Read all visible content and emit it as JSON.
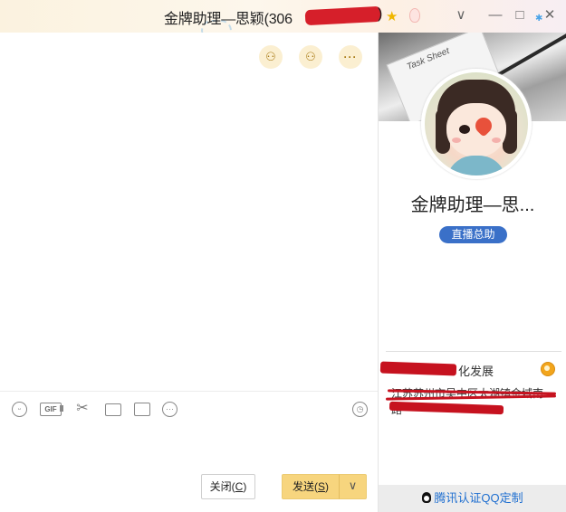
{
  "window": {
    "title": "金牌助理—思颖(306",
    "title_suffix": ")",
    "controls": {
      "dropdown": "∨",
      "minimize": "—",
      "maximize": "□",
      "close": "✕"
    }
  },
  "chat": {
    "toolbar_icons": [
      "smile-icon",
      "gif-icon",
      "scissors-icon",
      "folder-icon",
      "image-icon",
      "more-icon",
      "history-clock-icon"
    ],
    "gif_label": "GIF",
    "close_button": {
      "label": "关闭(",
      "key": "C",
      "end": ")"
    },
    "send_button": {
      "label": "发送(",
      "key": "S",
      "end": ")"
    },
    "send_dropdown": "∨",
    "top_icons": [
      "add-friend-icon",
      "invite-icon",
      "more-options-icon"
    ],
    "more_glyph": "···"
  },
  "sidebar": {
    "banner_text": "Task Sheet",
    "contact_name": "金牌助理—思...",
    "tag": "直播总助",
    "info_line1": "化发展",
    "info_line2": "江苏苏州市吴中区太湖镇金域南",
    "info_line3": "路",
    "footer": "腾讯认证QQ定制"
  },
  "colors": {
    "accent_send": "#f7d57e",
    "tag_blue": "#3a70c8",
    "footer_link": "#1f6fd0",
    "redaction": "#c6121f"
  }
}
